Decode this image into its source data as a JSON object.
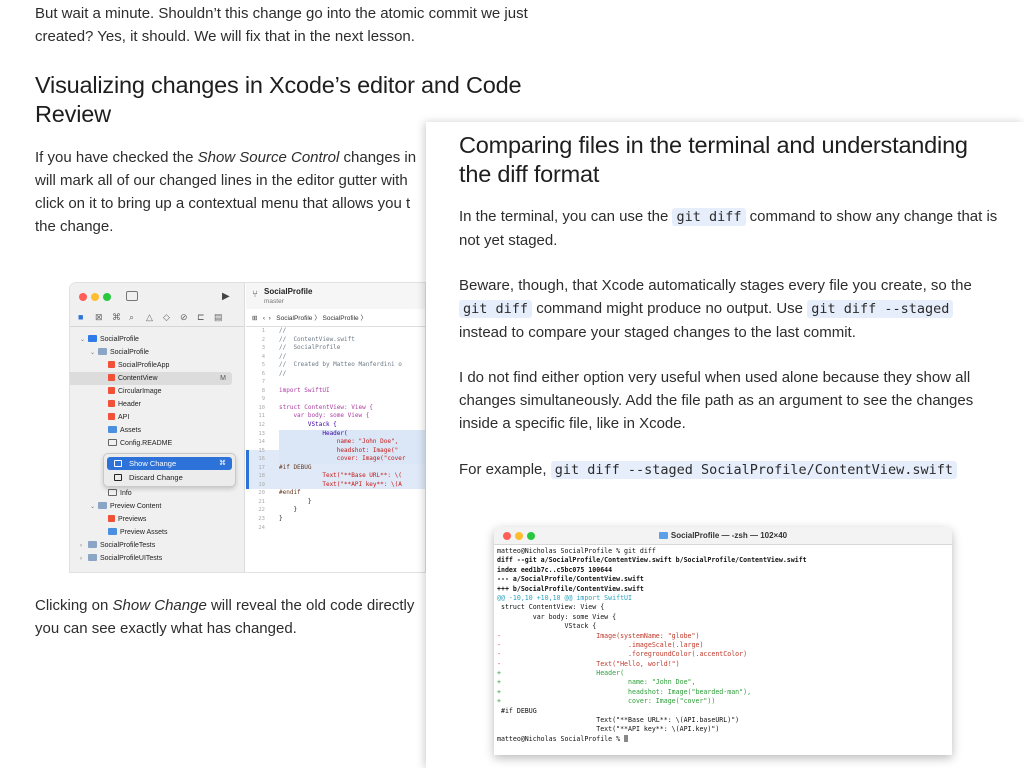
{
  "back_page": {
    "intro": "But wait a minute. Shouldn’t this change go into the atomic commit we just created? Yes, it should. We will fix that in the next lesson.",
    "heading": "Visualizing changes in Xcode’s editor and Code Review",
    "vis_para": {
      "pre": "If you have checked the ",
      "em": "Show Source Control",
      "post": " changes in",
      "line2": "will mark all of our changed lines in the editor gutter with",
      "line3": "click on it to bring up a contextual menu that allows you t",
      "line4": "the change."
    },
    "click_para": {
      "pre": "Clicking on ",
      "em": "Show Change",
      "post": " will reveal the old code directly",
      "line2": "you can see exactly what has changed."
    }
  },
  "xcode": {
    "project_title": "SocialProfile",
    "branch": "master",
    "jump_bar": "SocialProfile 〉 SocialProfile 〉",
    "navigator": [
      {
        "label": "SocialProfile",
        "icon": "proj",
        "indent": 0,
        "chev": "⌄"
      },
      {
        "label": "SocialProfile",
        "icon": "folder",
        "indent": 1,
        "chev": "⌄"
      },
      {
        "label": "SocialProfileApp",
        "icon": "swift",
        "indent": 2,
        "chev": ""
      },
      {
        "label": "ContentView",
        "icon": "swift",
        "indent": 2,
        "chev": "",
        "badge": "M",
        "selected": true
      },
      {
        "label": "CircularImage",
        "icon": "swift",
        "indent": 2,
        "chev": ""
      },
      {
        "label": "Header",
        "icon": "swift",
        "indent": 2,
        "chev": ""
      },
      {
        "label": "API",
        "icon": "swift",
        "indent": 2,
        "chev": ""
      },
      {
        "label": "Assets",
        "icon": "asset",
        "indent": 2,
        "chev": ""
      },
      {
        "label": "Config.README",
        "icon": "book",
        "indent": 2,
        "chev": ""
      },
      {
        "label": "Info",
        "icon": "book",
        "indent": 2,
        "chev": ""
      },
      {
        "label": "Preview Content",
        "icon": "folder",
        "indent": 1,
        "chev": "⌄"
      },
      {
        "label": "Previews",
        "icon": "swift",
        "indent": 2,
        "chev": ""
      },
      {
        "label": "Preview Assets",
        "icon": "asset",
        "indent": 2,
        "chev": ""
      },
      {
        "label": "SocialProfileTests",
        "icon": "folder",
        "indent": 0,
        "chev": "›"
      },
      {
        "label": "SocialProfileUITests",
        "icon": "folder",
        "indent": 0,
        "chev": "›"
      }
    ],
    "context_menu": {
      "show_change": "Show Change",
      "show_change_key": "⌘",
      "discard_change": "Discard Change"
    },
    "line_numbers": [
      "1",
      "2",
      "3",
      "4",
      "5",
      "6",
      "7",
      "8",
      "9",
      "10",
      "11",
      "12",
      "13",
      "14",
      "15",
      "16",
      "17",
      "18",
      "19",
      "20",
      "21",
      "22",
      "23",
      "24"
    ],
    "code_lines": [
      "//",
      "//  ContentView.swift",
      "//  SocialProfile",
      "//",
      "//  Created by Matteo Manferdini o",
      "//",
      "",
      "import SwiftUI",
      "",
      "struct ContentView: View {",
      "    var body: some View {",
      "        VStack {",
      "            Header(",
      "                name: \"John Doe\",",
      "                headshot: Image(\"",
      "                cover: Image(\"cover",
      "#if DEBUG",
      "            Text(\"**Base URL**: \\(",
      "            Text(\"**API key**: \\(A",
      "#endif",
      "        }",
      "    }",
      "}",
      ""
    ]
  },
  "front_page": {
    "heading": "Comparing files in the terminal and understanding the diff format",
    "p1": {
      "pre": "In the terminal, you can use the ",
      "code": "git diff",
      "post": " command to show any change that is not yet staged."
    },
    "p2": {
      "pre": "Beware, though, that Xcode automatically stages every file you create, so the ",
      "code1": "git diff",
      "mid": " command might produce no output. Use ",
      "code2": "git diff --staged",
      "post": " instead to compare your staged changes to the last commit."
    },
    "p3": "I do not find either option very useful when used alone because they show all changes simultaneously. Add the file path as an argument to see the changes inside a specific file, like in Xcode.",
    "p4": {
      "pre": "For example, ",
      "code": "git diff --staged SocialProfile/ContentView.swift"
    }
  },
  "terminal": {
    "title": "SocialProfile — -zsh — 102×40",
    "lines": [
      {
        "t": "matteo@Nicholas SocialProfile % git diff",
        "c": ""
      },
      {
        "t": "diff --git a/SocialProfile/ContentView.swift b/SocialProfile/ContentView.swift",
        "c": "t-b"
      },
      {
        "t": "index eed1b7c..c5bc075 100644",
        "c": "t-b"
      },
      {
        "t": "--- a/SocialProfile/ContentView.swift",
        "c": "t-b"
      },
      {
        "t": "+++ b/SocialProfile/ContentView.swift",
        "c": "t-b"
      },
      {
        "t": "@@ -10,10 +10,10 @@ import SwiftUI",
        "c": "t-cy"
      },
      {
        "t": " struct ContentView: View {",
        "c": ""
      },
      {
        "t": "         var body: some View {",
        "c": ""
      },
      {
        "t": "                 VStack {",
        "c": ""
      },
      {
        "t": "-                        Image(systemName: \"globe\")",
        "c": "t-red"
      },
      {
        "t": "-                                .imageScale(.large)",
        "c": "t-red"
      },
      {
        "t": "-                                .foregroundColor(.accentColor)",
        "c": "t-red"
      },
      {
        "t": "-                        Text(\"Hello, world!\")",
        "c": "t-red"
      },
      {
        "t": "+                        Header(",
        "c": "t-grn"
      },
      {
        "t": "+                                name: \"John Doe\",",
        "c": "t-grn"
      },
      {
        "t": "+                                headshot: Image(\"bearded-man\"),",
        "c": "t-grn"
      },
      {
        "t": "+                                cover: Image(\"cover\"))",
        "c": "t-grn"
      },
      {
        "t": " #if DEBUG",
        "c": ""
      },
      {
        "t": "                         Text(\"**Base URL**: \\(API.baseURL)\")",
        "c": ""
      },
      {
        "t": "                         Text(\"**API key**: \\(API.key)\")",
        "c": ""
      },
      {
        "t": "matteo@Nicholas SocialProfile % ",
        "c": "",
        "cursor": true
      }
    ]
  }
}
